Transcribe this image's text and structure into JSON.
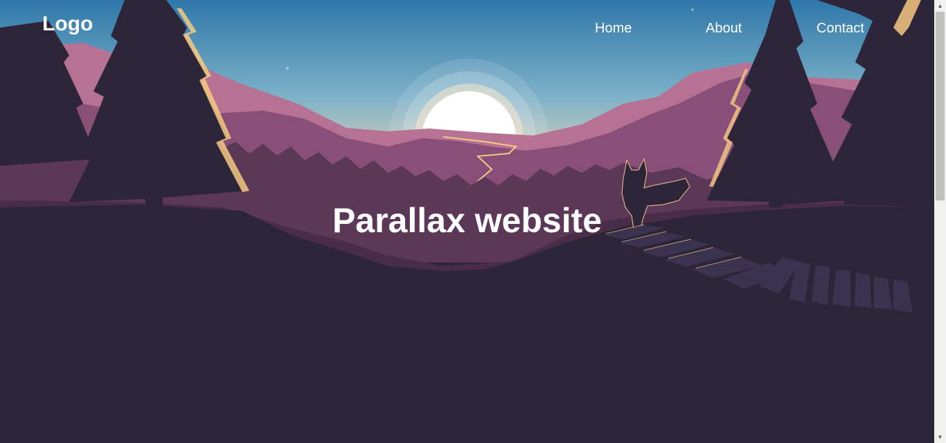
{
  "header": {
    "logo": "Logo",
    "nav": [
      {
        "label": "Home"
      },
      {
        "label": "About"
      },
      {
        "label": "Contact"
      }
    ]
  },
  "hero": {
    "title": "Parallax website"
  },
  "colors": {
    "background": "#2d2539",
    "sky_top": "#2f78aa",
    "sky_bottom": "#f3d7b5",
    "sun": "#ffffff",
    "mountain_far": "#b57293",
    "mountain_mid": "#8a4f78",
    "mountain_near": "#5b3758",
    "highlight": "#f7c983",
    "text": "#ffffff"
  },
  "icons": {
    "scroll_up": "triangle-up-icon",
    "scroll_down": "triangle-down-icon"
  }
}
